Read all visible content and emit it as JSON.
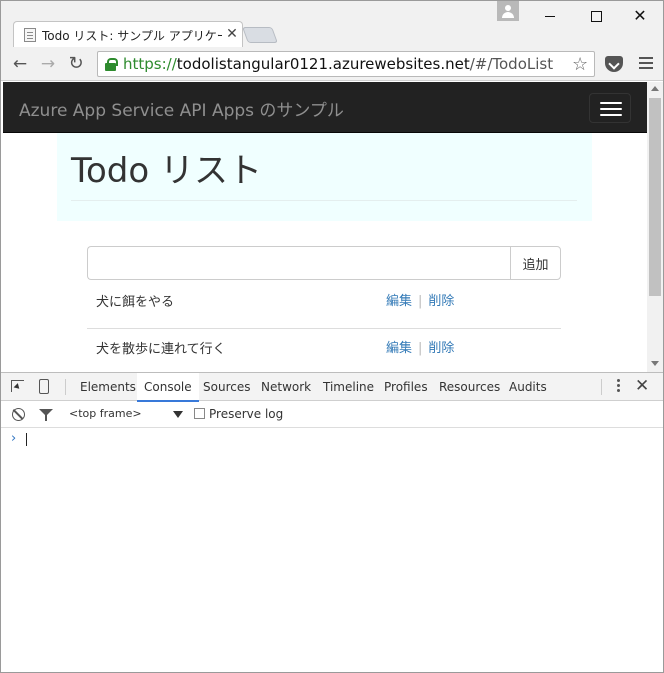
{
  "browser": {
    "tab": {
      "title": "Todo リスト: サンプル アプリケーション"
    },
    "address": {
      "scheme": "https://",
      "host": "todolistangular0121.azurewebsites.net",
      "path": "/#/TodoList"
    },
    "icons": {
      "back": "arrow-left-icon",
      "forward": "arrow-right-icon",
      "reload": "reload-icon",
      "lock": "lock-icon",
      "bookmark": "star-icon",
      "pocket": "pocket-icon",
      "menu": "menu-icon"
    }
  },
  "page": {
    "navbar": {
      "brand": "Azure App Service API Apps のサンプル"
    },
    "title": "Todo リスト",
    "input": {
      "value": "",
      "add_label": "追加"
    },
    "todos": [
      {
        "text": "犬に餌をやる",
        "edit_label": "編集",
        "delete_label": "削除"
      },
      {
        "text": "犬を散歩に連れて行く",
        "edit_label": "編集",
        "delete_label": "削除"
      }
    ],
    "colors": {
      "navbar": "#222222",
      "jumbotron": "#f0ffff",
      "link": "#337ab7"
    }
  },
  "devtools": {
    "tabs": [
      "Elements",
      "Console",
      "Sources",
      "Network",
      "Timeline",
      "Profiles",
      "Resources",
      "Audits"
    ],
    "active_tab": "Console",
    "frame": "<top frame>",
    "preserve_log_label": "Preserve log",
    "prompt": "›"
  }
}
